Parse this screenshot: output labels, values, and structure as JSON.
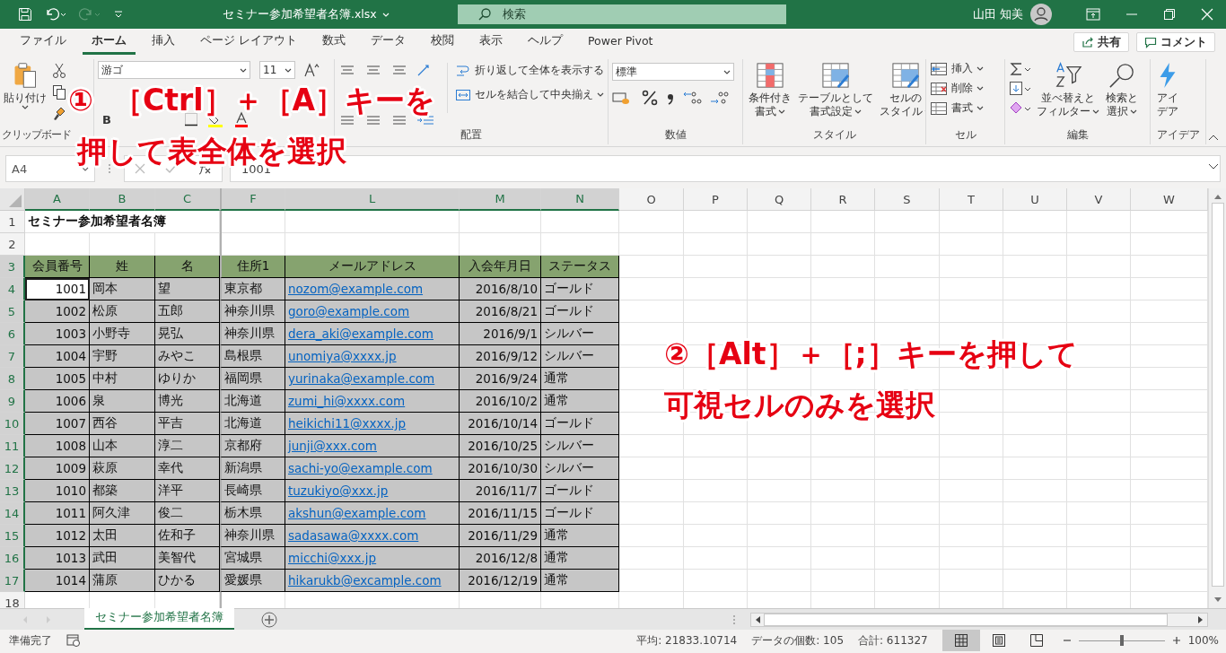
{
  "title_bar": {
    "file_name": "セミナー参加希望者名簿.xlsx",
    "search_placeholder": "検索",
    "user_name": "山田 知美"
  },
  "menu_tabs": [
    {
      "label": "ファイル",
      "selected": false
    },
    {
      "label": "ホーム",
      "selected": true
    },
    {
      "label": "挿入",
      "selected": false
    },
    {
      "label": "ページ レイアウト",
      "selected": false
    },
    {
      "label": "数式",
      "selected": false
    },
    {
      "label": "データ",
      "selected": false
    },
    {
      "label": "校閲",
      "selected": false
    },
    {
      "label": "表示",
      "selected": false
    },
    {
      "label": "ヘルプ",
      "selected": false
    },
    {
      "label": "Power Pivot",
      "selected": false
    }
  ],
  "share_button": "共有",
  "comment_button": "コメント",
  "ribbon": {
    "clipboard": {
      "paste": "貼り付け",
      "label": "クリップボード"
    },
    "font": {
      "name": "游ゴ",
      "size": "11",
      "bold": "B"
    },
    "alignment": {
      "wrap_text": "折り返して全体を表示する",
      "merge_center": "セルを結合して中央揃え",
      "label": "配置"
    },
    "number": {
      "format": "標準",
      "label": "数値"
    },
    "styles": {
      "buttons": [
        [
          "条件付き",
          "書式"
        ],
        [
          "テーブルとして",
          "書式設定"
        ],
        [
          "セルの",
          "スタイル"
        ]
      ],
      "label": "スタイル"
    },
    "cells": {
      "buttons": [
        "挿入",
        "削除",
        "書式"
      ],
      "label": "セル"
    },
    "editing": {
      "buttons": [
        [
          "並べ替えと",
          "フィルター"
        ],
        [
          "検索と",
          "選択"
        ]
      ],
      "label": "編集"
    },
    "ideas": {
      "button": [
        "アイ",
        "デア"
      ],
      "label": "アイデア"
    }
  },
  "formula_bar": {
    "name_box": "A4",
    "formula": "1001"
  },
  "columns": [
    {
      "letter": "A",
      "selected": true
    },
    {
      "letter": "B",
      "selected": true
    },
    {
      "letter": "C",
      "selected": true
    },
    {
      "letter": "F",
      "selected": true
    },
    {
      "letter": "L",
      "selected": true
    },
    {
      "letter": "M",
      "selected": true
    },
    {
      "letter": "N",
      "selected": true
    },
    {
      "letter": "O",
      "selected": false
    },
    {
      "letter": "P",
      "selected": false
    },
    {
      "letter": "Q",
      "selected": false
    },
    {
      "letter": "R",
      "selected": false
    },
    {
      "letter": "S",
      "selected": false
    },
    {
      "letter": "T",
      "selected": false
    },
    {
      "letter": "U",
      "selected": false
    },
    {
      "letter": "V",
      "selected": false
    },
    {
      "letter": "W",
      "selected": false
    }
  ],
  "row_numbers": [
    {
      "label": "1",
      "selected": false
    },
    {
      "label": "2",
      "selected": false
    },
    {
      "label": "3",
      "selected": true
    },
    {
      "label": "4",
      "selected": true
    },
    {
      "label": "5",
      "selected": true
    },
    {
      "label": "6",
      "selected": true
    },
    {
      "label": "7",
      "selected": true
    },
    {
      "label": "8",
      "selected": true
    },
    {
      "label": "9",
      "selected": true
    },
    {
      "label": "10",
      "selected": true
    },
    {
      "label": "11",
      "selected": true
    },
    {
      "label": "12",
      "selected": true
    },
    {
      "label": "13",
      "selected": true
    },
    {
      "label": "14",
      "selected": true
    },
    {
      "label": "15",
      "selected": true
    },
    {
      "label": "16",
      "selected": true
    },
    {
      "label": "17",
      "selected": true
    },
    {
      "label": "18",
      "selected": false
    }
  ],
  "sheet_title": "セミナー参加希望者名簿",
  "table": {
    "headers": [
      "会員番号",
      "姓",
      "名",
      "住所1",
      "メールアドレス",
      "入会年月日",
      "ステータス"
    ],
    "rows": [
      {
        "active": true,
        "cells": [
          "1001",
          "岡本",
          "望",
          "東京都",
          "nozom@example.com",
          "2016/8/10",
          "ゴールド"
        ]
      },
      {
        "active": false,
        "cells": [
          "1002",
          "松原",
          "五郎",
          "神奈川県",
          "goro@example.com",
          "2016/8/21",
          "ゴールド"
        ]
      },
      {
        "active": false,
        "cells": [
          "1003",
          "小野寺",
          "晃弘",
          "神奈川県",
          "dera_aki@example.com",
          "2016/9/1",
          "シルバー"
        ]
      },
      {
        "active": false,
        "cells": [
          "1004",
          "宇野",
          "みやこ",
          "島根県",
          "unomiya@xxxx.jp",
          "2016/9/12",
          "シルバー"
        ]
      },
      {
        "active": false,
        "cells": [
          "1005",
          "中村",
          "ゆりか",
          "福岡県",
          "yurinaka@example.com",
          "2016/9/24",
          "通常"
        ]
      },
      {
        "active": false,
        "cells": [
          "1006",
          "泉",
          "博光",
          "北海道",
          "zumi_hi@xxxx.com",
          "2016/10/2",
          "通常"
        ]
      },
      {
        "active": false,
        "cells": [
          "1007",
          "西谷",
          "平吉",
          "北海道",
          "heikichi11@xxxx.jp",
          "2016/10/14",
          "ゴールド"
        ]
      },
      {
        "active": false,
        "cells": [
          "1008",
          "山本",
          "淳二",
          "京都府",
          "junji@xxx.com",
          "2016/10/25",
          "シルバー"
        ]
      },
      {
        "active": false,
        "cells": [
          "1009",
          "萩原",
          "幸代",
          "新潟県",
          "sachi-yo@example.com",
          "2016/10/30",
          "シルバー"
        ]
      },
      {
        "active": false,
        "cells": [
          "1010",
          "都築",
          "洋平",
          "長崎県",
          "tuzukiyo@xxx.jp",
          "2016/11/7",
          "ゴールド"
        ]
      },
      {
        "active": false,
        "cells": [
          "1011",
          "阿久津",
          "俊二",
          "栃木県",
          "akshun@example.com",
          "2016/11/15",
          "ゴールド"
        ]
      },
      {
        "active": false,
        "cells": [
          "1012",
          "太田",
          "佐和子",
          "神奈川県",
          "sadasawa@xxxx.com",
          "2016/11/29",
          "通常"
        ]
      },
      {
        "active": false,
        "cells": [
          "1013",
          "武田",
          "美智代",
          "宮城県",
          "micchi@xxx.jp",
          "2016/12/8",
          "通常"
        ]
      },
      {
        "active": false,
        "cells": [
          "1014",
          "蒲原",
          "ひかる",
          "愛媛県",
          "hikarukb@excample.com",
          "2016/12/19",
          "通常"
        ]
      }
    ]
  },
  "sheet_tabs": [
    {
      "label": "セミナー参加希望者名簿",
      "selected": true
    }
  ],
  "status_bar": {
    "ready": "準備完了",
    "average": "平均: 21833.10714",
    "count": "データの個数: 105",
    "sum": "合計: 611327",
    "views": [
      {
        "kind": "normal",
        "selected": true
      },
      {
        "kind": "page_layout",
        "selected": false
      },
      {
        "kind": "page_break",
        "selected": false
      }
    ],
    "zoom": {
      "level": 0.5,
      "reading": "100%"
    }
  },
  "annotations": [
    {
      "lines": [
        [
          "①",
          "［Ctrl］＋［A］キーを"
        ],
        [
          "押して表全体を選択"
        ]
      ]
    },
    {
      "lines": [
        [
          "②［Alt］＋［;］キーを押して"
        ],
        [
          "可視セルのみを選択"
        ]
      ]
    }
  ]
}
